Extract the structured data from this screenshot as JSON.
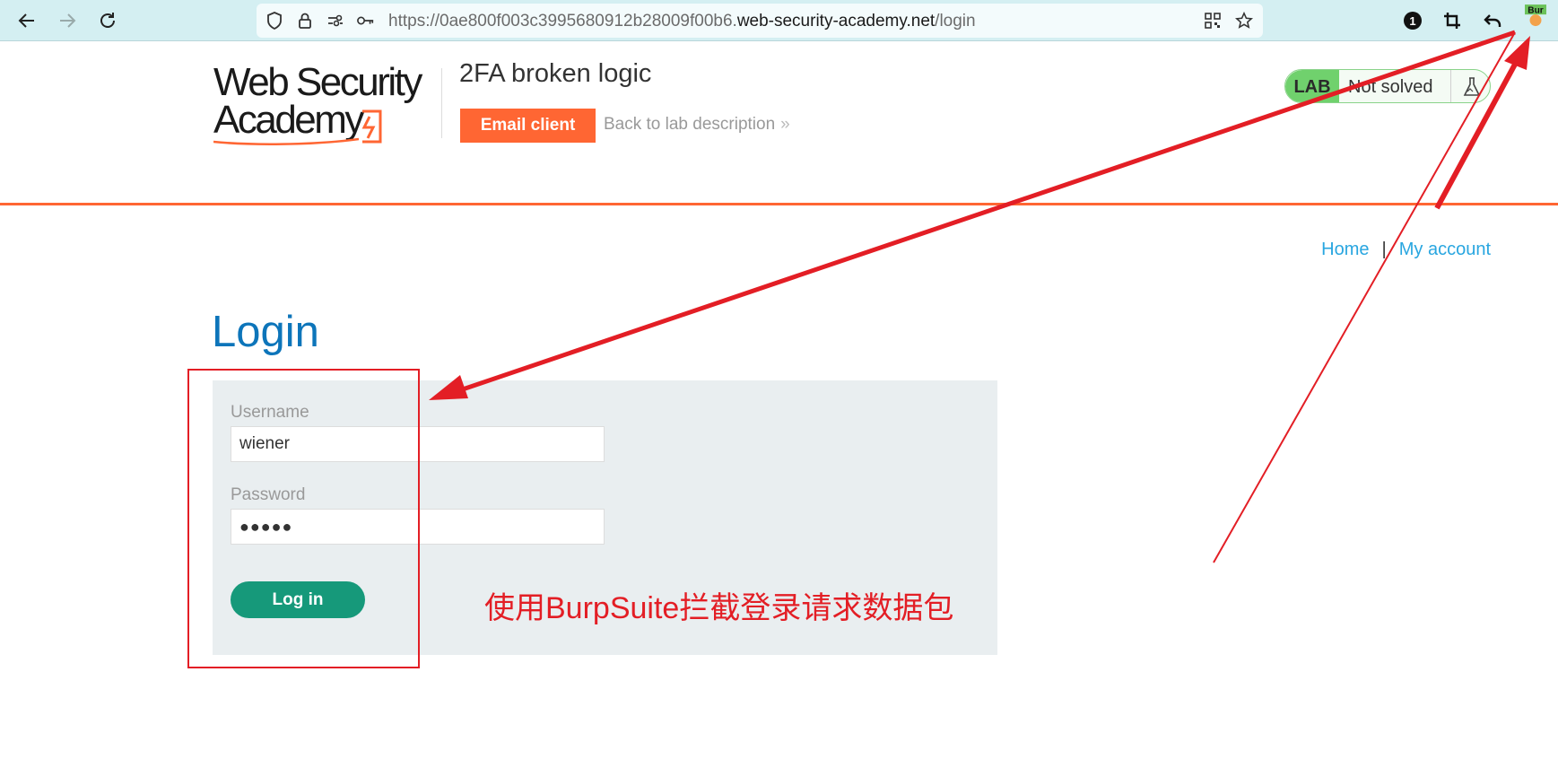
{
  "browser": {
    "url_prefix": "https://0ae800f003c3995680912b28009f00b6.",
    "url_host": "web-security-academy.net",
    "url_path": "/login",
    "badge_count": "1",
    "ext_label": "Bur",
    "icons": [
      "back-icon",
      "forward-icon",
      "reload-icon",
      "shield-icon",
      "lock-icon",
      "permissions-icon",
      "key-icon",
      "qr-code-icon",
      "star-icon",
      "crop-icon",
      "undo-icon",
      "burp-extension-icon"
    ]
  },
  "header": {
    "logo_line1": "Web Security",
    "logo_line2": "Academy",
    "lab_title": "2FA broken logic",
    "email_button": "Email client",
    "back_link": "Back to lab description",
    "back_chevron": "»",
    "lab_badge": "LAB",
    "lab_status": "Not solved"
  },
  "nav": {
    "home": "Home",
    "separator": "|",
    "my_account": "My account"
  },
  "login": {
    "title": "Login",
    "username_label": "Username",
    "username_value": "wiener",
    "password_label": "Password",
    "password_value": "●●●●●",
    "submit": "Log in"
  },
  "annotation": {
    "text": "使用BurpSuite拦截登录请求数据包",
    "color": "#e31e25"
  },
  "colors": {
    "accent": "#ff6633",
    "link": "#29a6e0",
    "login_title": "#0d75ba",
    "button": "#16997a",
    "lab_green": "#70d16d"
  }
}
